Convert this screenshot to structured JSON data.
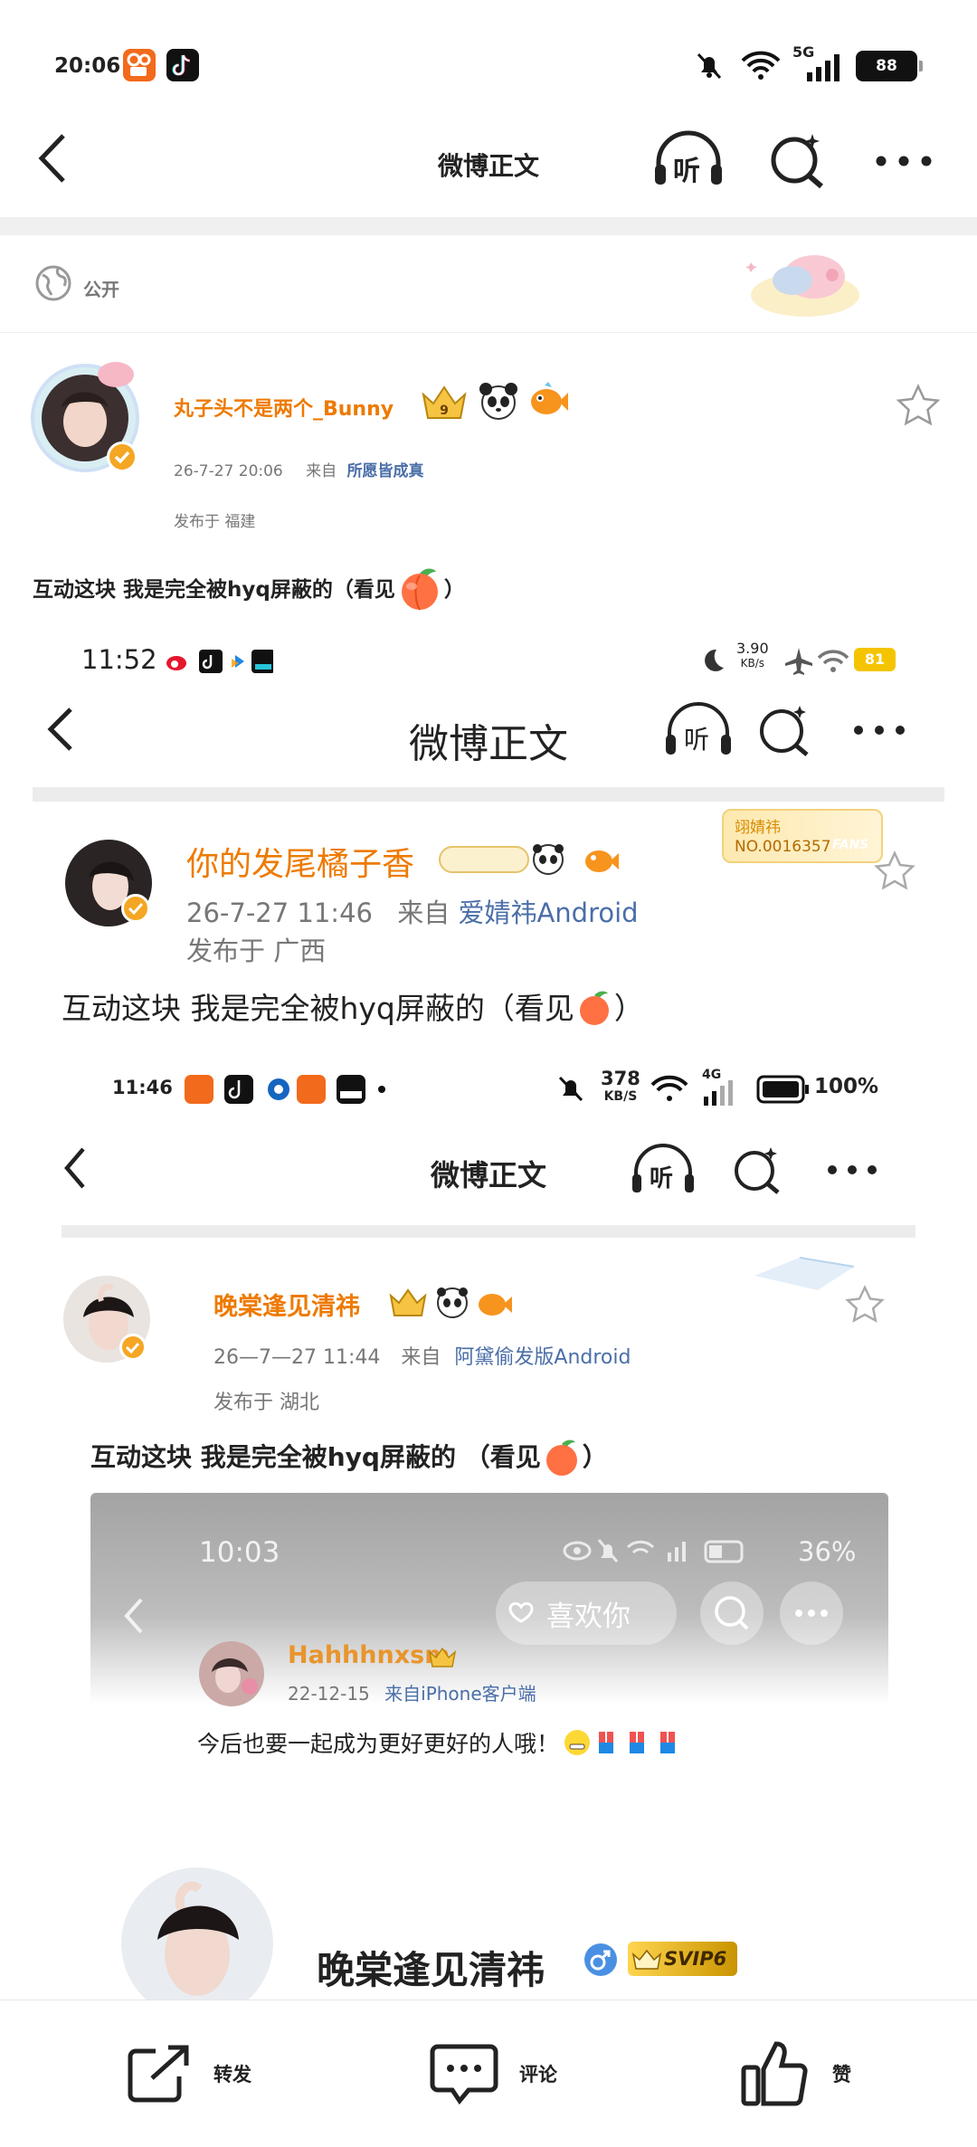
{
  "status_bar": {
    "time": "20:06",
    "network": "5G",
    "battery": "88"
  },
  "nav": {
    "title": "微博正文",
    "listen_label": "听"
  },
  "visibility": {
    "label": "公开"
  },
  "post": {
    "author": "丸子头不是两个_Bunny",
    "timestamp": "26-7-27 20:06",
    "source_prefix": "来自",
    "source": "所愿皆成真",
    "location": "发布于 福建",
    "text_before": "互动这块 我是完全被hyq屏蔽的（看见",
    "text_after": "）"
  },
  "embed1": {
    "status_time": "11:52",
    "speed_value": "3.90",
    "speed_unit": "KB/s",
    "battery": "81",
    "nav_title": "微博正文",
    "listen_label": "听",
    "fans_badge_name": "翊婧祎",
    "fans_badge_no": "NO.0016357",
    "fans_badge_tag": "FANS",
    "author": "你的发尾橘子香",
    "timestamp": "26-7-27 11:46",
    "source_prefix": "来自",
    "source": "爱婧祎Android",
    "location": "发布于 广西",
    "text_before": "互动这块 我是完全被hyq屏蔽的（看见",
    "text_after": "）"
  },
  "embed2": {
    "status_time": "11:46",
    "speed_value": "378",
    "speed_unit": "KB/S",
    "network": "4G",
    "battery": "100%",
    "nav_title": "微博正文",
    "listen_label": "听",
    "author": "晚棠逢见清祎",
    "timestamp": "26—7—27  11:44",
    "source_prefix": "来自",
    "source": "阿黛偷发版Android",
    "location": "发布于  湖北",
    "text_before": "互动这块  我是完全被hyq屏蔽的  （看见",
    "text_after": "）"
  },
  "embed3": {
    "status_time": "10:03",
    "battery": "36%",
    "like_label": "喜欢你",
    "author": "Hahhhnxsm",
    "timestamp": "22-12-15",
    "source": "来自iPhone客户端",
    "text": "今后也要一起成为更好更好的人哦！",
    "profile_name": "晚棠逢见清祎",
    "svip": "SVIP6"
  },
  "bottom_bar": {
    "repost": "转发",
    "comment": "评论",
    "like": "赞"
  },
  "colors": {
    "accent_orange": "#ee7a00",
    "link_blue": "#4a6ea8",
    "battery_yellow": "#f5c400"
  }
}
